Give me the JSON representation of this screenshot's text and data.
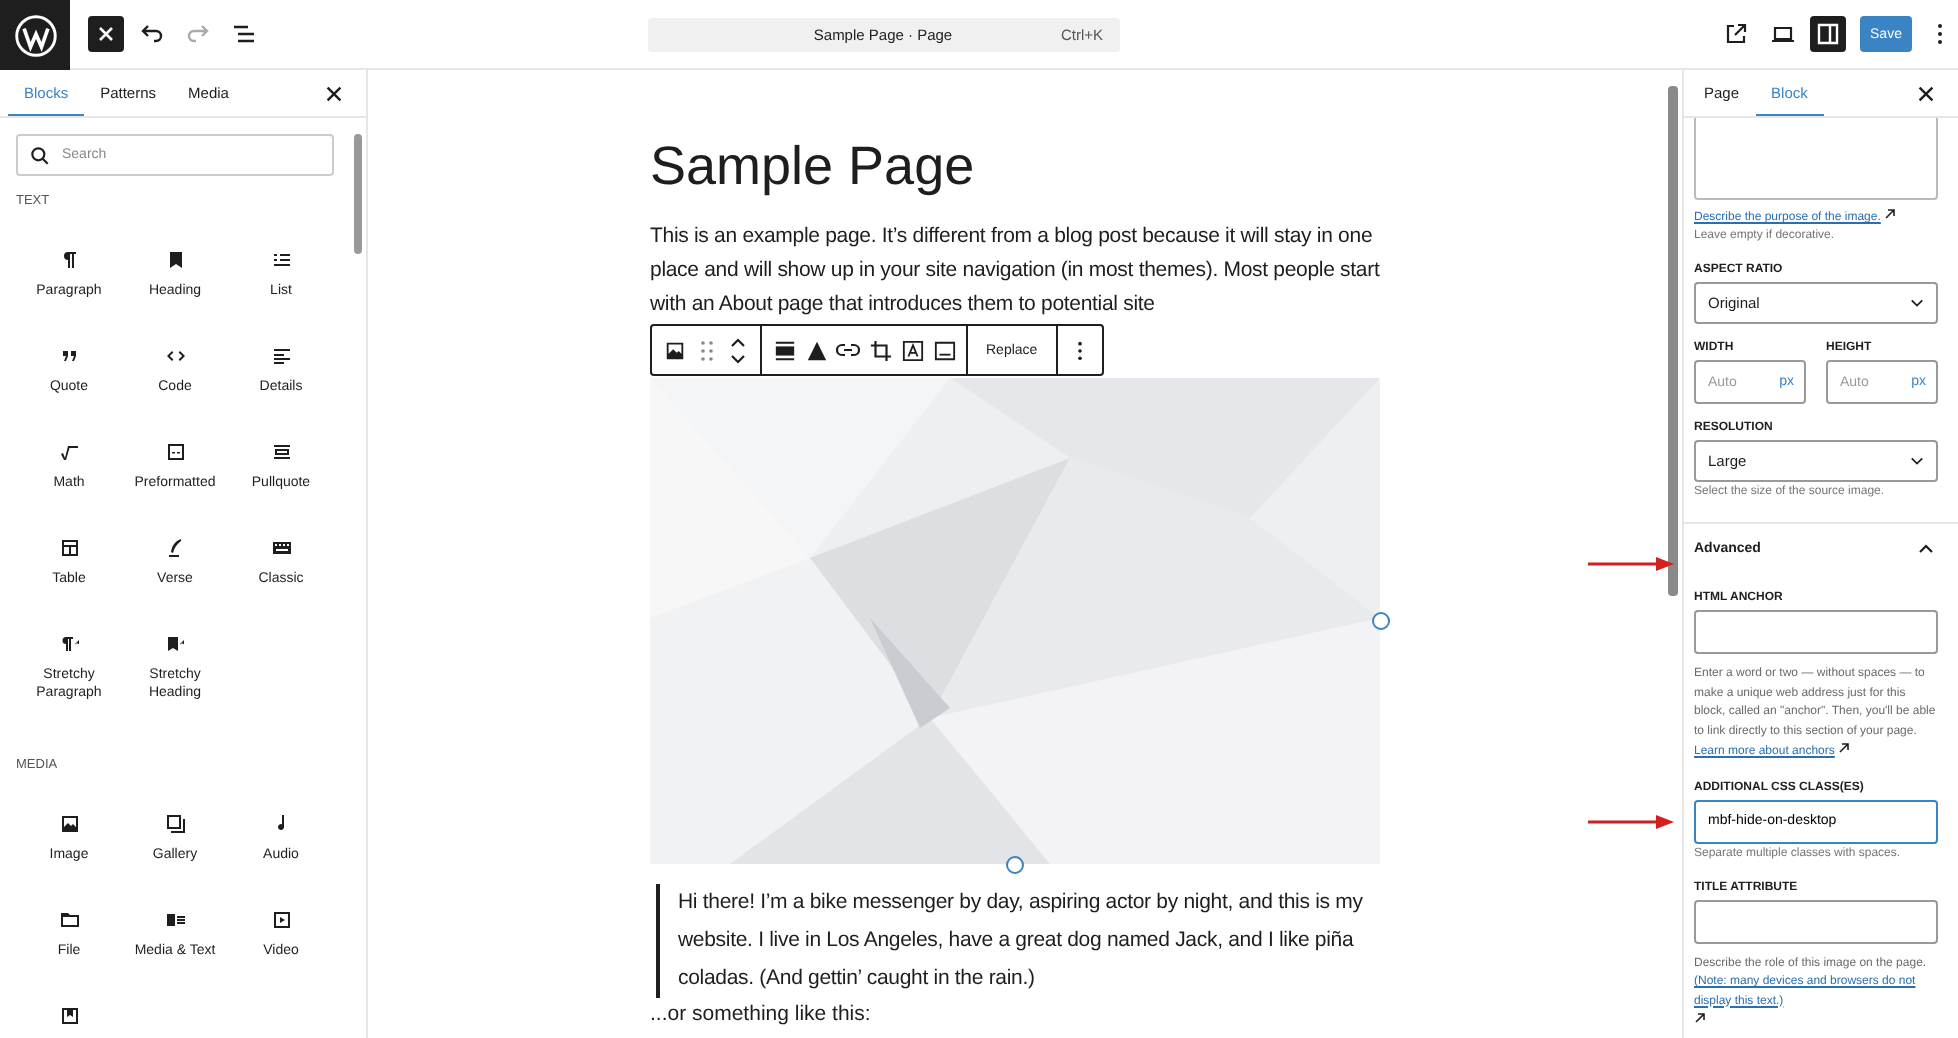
{
  "topbar": {
    "inserter_open": true,
    "command": {
      "title": "Sample Page · Page",
      "shortcut": "Ctrl+K"
    },
    "settings_open": true,
    "save": "Save"
  },
  "inserter": {
    "tabs": [
      {
        "label": "Blocks",
        "selected": true
      },
      {
        "label": "Patterns",
        "selected": false
      },
      {
        "label": "Media",
        "selected": false
      }
    ],
    "search": {
      "placeholder": "Search"
    },
    "categories": [
      {
        "title": "TEXT",
        "blocks": [
          {
            "label": "Paragraph"
          },
          {
            "label": "Heading"
          },
          {
            "label": "List"
          },
          {
            "label": "Quote"
          },
          {
            "label": "Code"
          },
          {
            "label": "Details"
          },
          {
            "label": "Math"
          },
          {
            "label": "Preformatted"
          },
          {
            "label": "Pullquote"
          },
          {
            "label": "Table"
          },
          {
            "label": "Verse"
          },
          {
            "label": "Classic"
          },
          {
            "label": "Stretchy Paragraph"
          },
          {
            "label": "Stretchy Heading"
          }
        ]
      },
      {
        "title": "MEDIA",
        "blocks": [
          {
            "label": "Image"
          },
          {
            "label": "Gallery"
          },
          {
            "label": "Audio"
          },
          {
            "label": "File"
          },
          {
            "label": "Media & Text"
          },
          {
            "label": "Video"
          }
        ],
        "more_below": true
      }
    ]
  },
  "editor": {
    "title": "Sample Page",
    "paragraph": "This is an example page. It’s different from a blog post because it will stay in one place and will show up in your site navigation (in most themes). Most people start with an About page that introduces them to potential site",
    "toolbar": {
      "replace": "Replace"
    },
    "image": {
      "kind": "picture",
      "selected": true
    },
    "quote": "Hi there! I’m a bike messenger by day, aspiring actor by night, and this is my website. I live in Los Angeles, have a great dog named Jack, and I like piña coladas. (And gettin’ caught in the rain.)",
    "after": "...or something like this:"
  },
  "settings": {
    "tabs": [
      {
        "label": "Page",
        "selected": false
      },
      {
        "label": "Block",
        "selected": true
      }
    ],
    "alt_link": "Describe the purpose of the image.",
    "alt_hint": "Leave empty if decorative.",
    "aspect_ratio": {
      "label": "ASPECT RATIO",
      "value": "Original"
    },
    "width": {
      "label": "WIDTH",
      "placeholder": "Auto",
      "unit": "px"
    },
    "height": {
      "label": "HEIGHT",
      "placeholder": "Auto",
      "unit": "px"
    },
    "resolution": {
      "label": "RESOLUTION",
      "value": "Large",
      "hint": "Select the size of the source image."
    },
    "advanced": {
      "title": "Advanced",
      "expanded": true,
      "anchor": {
        "label": "HTML ANCHOR",
        "help": "Enter a word or two — without spaces — to make a unique web address just for this block, called an \"anchor\". Then, you'll be able to link directly to this section of your page.",
        "link": "Learn more about anchors"
      },
      "css_class": {
        "label": "ADDITIONAL CSS CLASS(ES)",
        "value": "mbf-hide-on-desktop",
        "hint": "Separate multiple classes with spaces."
      },
      "title_attr": {
        "label": "TITLE ATTRIBUTE",
        "help": "Describe the role of this image on the page.",
        "link": "(Note: many devices and browsers do not display this text.)"
      }
    }
  }
}
